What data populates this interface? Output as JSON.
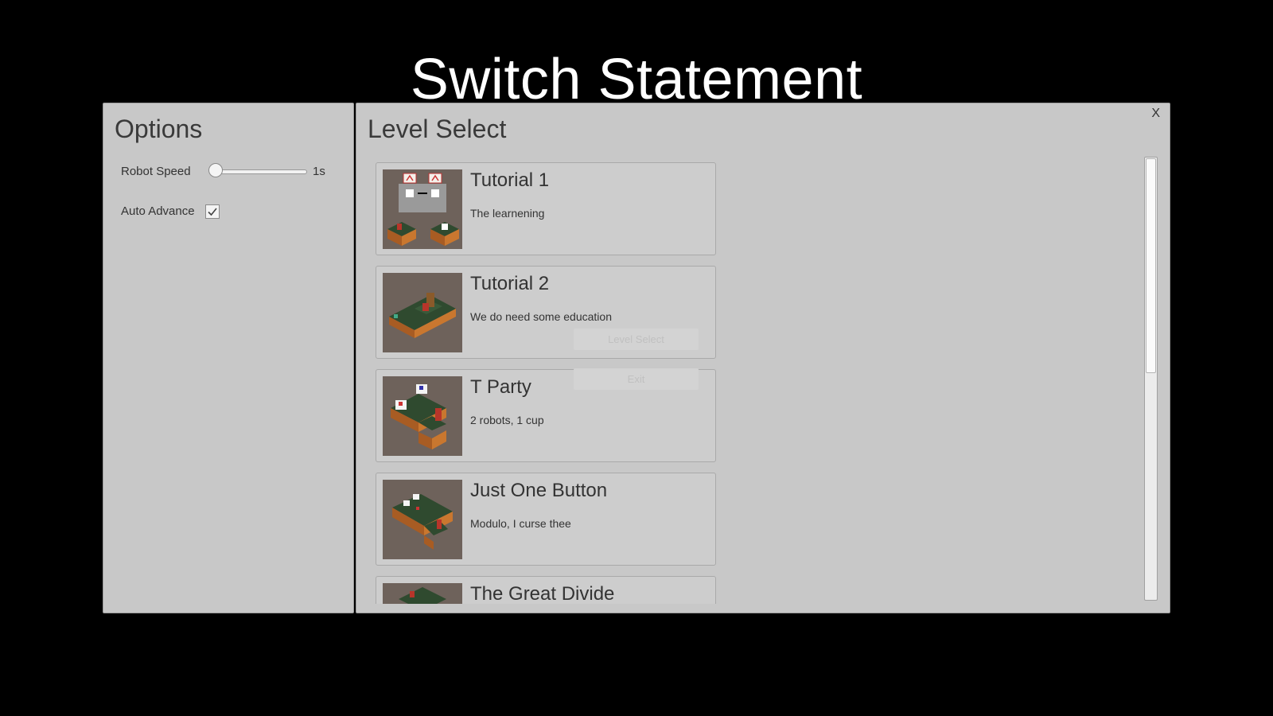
{
  "game_title": "Switch Statement",
  "options": {
    "title": "Options",
    "robot_speed_label": "Robot Speed",
    "robot_speed_value": "1s",
    "robot_speed_fraction": 0.0,
    "auto_advance_label": "Auto Advance",
    "auto_advance_checked": true
  },
  "level_select": {
    "title": "Level Select",
    "close_label": "X",
    "scroll_fraction": 0.0,
    "levels": [
      {
        "name": "Tutorial 1",
        "description": "The learnening",
        "thumbnail": "tutorial-1-thumbnail"
      },
      {
        "name": "Tutorial 2",
        "description": "We do need some education",
        "thumbnail": "tutorial-2-thumbnail"
      },
      {
        "name": "T Party",
        "description": "2 robots, 1 cup",
        "thumbnail": "t-party-thumbnail"
      },
      {
        "name": "Just One Button",
        "description": "Modulo, I curse thee",
        "thumbnail": "just-one-button-thumbnail"
      },
      {
        "name": "The Great Divide",
        "description": "",
        "thumbnail": "the-great-divide-thumbnail"
      }
    ]
  },
  "background_menu": {
    "level_select_label": "Level Select",
    "exit_label": "Exit"
  },
  "colors": {
    "background": "#000000",
    "panel": "#c8c8c8",
    "tile_top": "#2f4a2f",
    "tile_side": "#b5652a"
  }
}
